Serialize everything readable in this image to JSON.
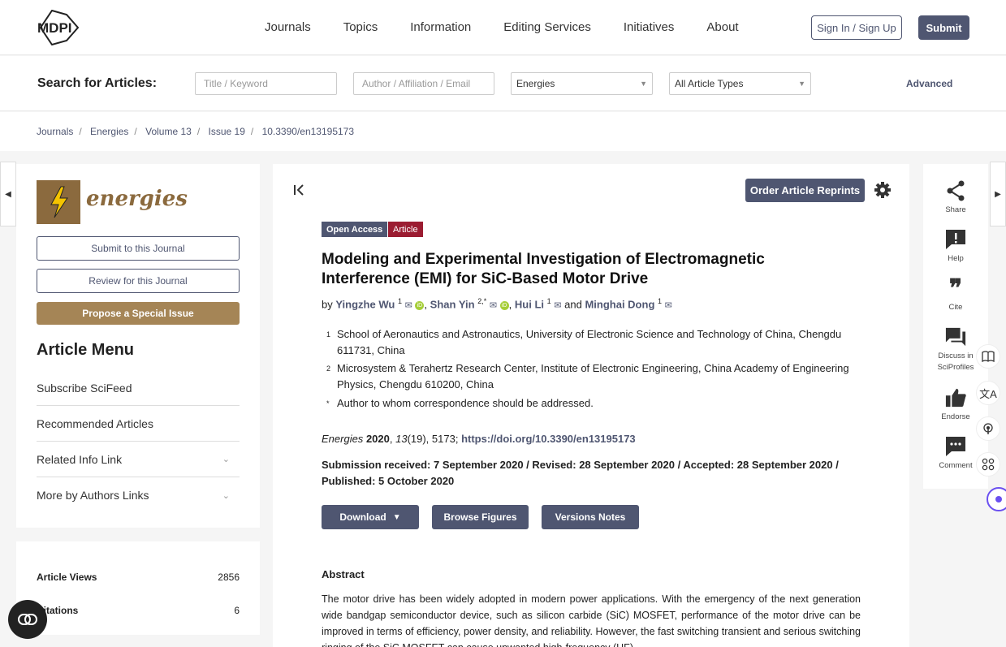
{
  "header": {
    "logo_text": "MDPI",
    "nav": [
      "Journals",
      "Topics",
      "Information",
      "Editing Services",
      "Initiatives",
      "About"
    ],
    "signin_label": "Sign In / Sign Up",
    "submit_label": "Submit"
  },
  "search": {
    "title": "Search for Articles:",
    "title_placeholder": "Title / Keyword",
    "author_placeholder": "Author / Affiliation / Email",
    "journal_value": "Energies",
    "type_value": "All Article Types",
    "advanced_label": "Advanced"
  },
  "breadcrumb": [
    "Journals",
    "Energies",
    "Volume 13",
    "Issue 19",
    "10.3390/en13195173"
  ],
  "left": {
    "journal_name": "energies",
    "submit_btn": "Submit to this Journal",
    "review_btn": "Review for this Journal",
    "propose_btn": "Propose a Special Issue",
    "menu_title": "Article Menu",
    "menu_items": [
      "Subscribe SciFeed",
      "Recommended Articles",
      "Related Info Link",
      "More by Authors Links"
    ],
    "stats": [
      {
        "label": "Article Views",
        "value": "2856"
      },
      {
        "label": "Citations",
        "value": "6"
      }
    ]
  },
  "article": {
    "reprint_btn": "Order Article Reprints",
    "badge_oa": "Open Access",
    "badge_type": "Article",
    "title": "Modeling and Experimental Investigation of Electromagnetic Interference (EMI) for SiC-Based Motor Drive",
    "by": "by",
    "authors": [
      {
        "name": "Yingzhe Wu",
        "sup": "1"
      },
      {
        "name": "Shan Yin",
        "sup": "2,*"
      },
      {
        "name": "Hui Li",
        "sup": "1"
      },
      {
        "name": "Minghai Dong",
        "sup": "1"
      }
    ],
    "and_word": "and",
    "affiliations": [
      {
        "num": "1",
        "text": "School of Aeronautics and Astronautics, University of Electronic Science and Technology of China, Chengdu 611731, China"
      },
      {
        "num": "2",
        "text": "Microsystem & Terahertz Research Center, Institute of Electronic Engineering, China Academy of Engineering Physics, Chengdu 610200, China"
      },
      {
        "num": "*",
        "text": "Author to whom correspondence should be addressed."
      }
    ],
    "cite_journal": "Energies",
    "cite_year": "2020",
    "cite_volume": "13",
    "cite_rest": "(19), 5173;",
    "cite_doi": "https://doi.org/10.3390/en13195173",
    "dates": "Submission received: 7 September 2020 / Revised: 28 September 2020 / Accepted: 28 September 2020 / Published: 5 October 2020",
    "download_btn": "Download",
    "figures_btn": "Browse Figures",
    "versions_btn": "Versions Notes",
    "abstract_title": "Abstract",
    "abstract_text": "The motor drive has been widely adopted in modern power applications. With the emergency of the next generation wide bandgap semiconductor device, such as silicon carbide (SiC) MOSFET, performance of the motor drive can be improved in terms of efficiency, power density, and reliability. However, the fast switching transient and serious switching ringing of the SiC MOSFET can cause unwanted high-frequency (HF)"
  },
  "right": {
    "items": [
      "Share",
      "Help",
      "Cite",
      "Discuss in SciProfiles",
      "Endorse",
      "Comment"
    ]
  },
  "colors": {
    "primary": "#4f5671",
    "brown": "#a58556",
    "article_badge": "#9b1c31"
  }
}
